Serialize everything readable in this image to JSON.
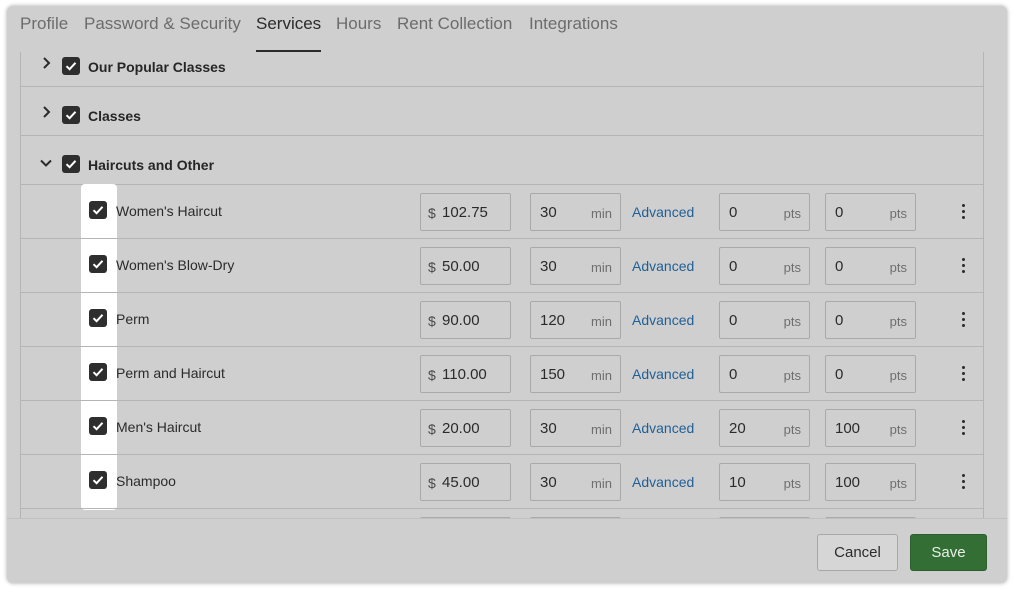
{
  "tabs": [
    {
      "label": "Profile",
      "active": false
    },
    {
      "label": "Password & Security",
      "active": false
    },
    {
      "label": "Services",
      "active": true
    },
    {
      "label": "Hours",
      "active": false
    },
    {
      "label": "Rent Collection",
      "active": false
    },
    {
      "label": "Integrations",
      "active": false
    }
  ],
  "groups": [
    {
      "label": "Our Popular Classes",
      "expanded": false,
      "checked": true
    },
    {
      "label": "Classes",
      "expanded": false,
      "checked": true
    },
    {
      "label": "Haircuts and Other",
      "expanded": true,
      "checked": true
    }
  ],
  "currency_symbol": "$",
  "duration_unit": "min",
  "points_unit": "pts",
  "advanced_label": "Advanced",
  "services": [
    {
      "name": "Women's Haircut",
      "checked": true,
      "price": "102.75",
      "duration": "30",
      "points_a": "0",
      "points_b": "0"
    },
    {
      "name": "Women's Blow-Dry",
      "checked": true,
      "price": "50.00",
      "duration": "30",
      "points_a": "0",
      "points_b": "0"
    },
    {
      "name": "Perm",
      "checked": true,
      "price": "90.00",
      "duration": "120",
      "points_a": "0",
      "points_b": "0"
    },
    {
      "name": "Perm and Haircut",
      "checked": true,
      "price": "110.00",
      "duration": "150",
      "points_a": "0",
      "points_b": "0"
    },
    {
      "name": "Men's Haircut",
      "checked": true,
      "price": "20.00",
      "duration": "30",
      "points_a": "20",
      "points_b": "100"
    },
    {
      "name": "Shampoo",
      "checked": true,
      "price": "45.00",
      "duration": "30",
      "points_a": "10",
      "points_b": "100"
    }
  ],
  "footer": {
    "cancel_label": "Cancel",
    "save_label": "Save"
  },
  "colors": {
    "save_button": "#336e34",
    "link": "#1f5f96",
    "checkbox": "#2e2e2e"
  }
}
